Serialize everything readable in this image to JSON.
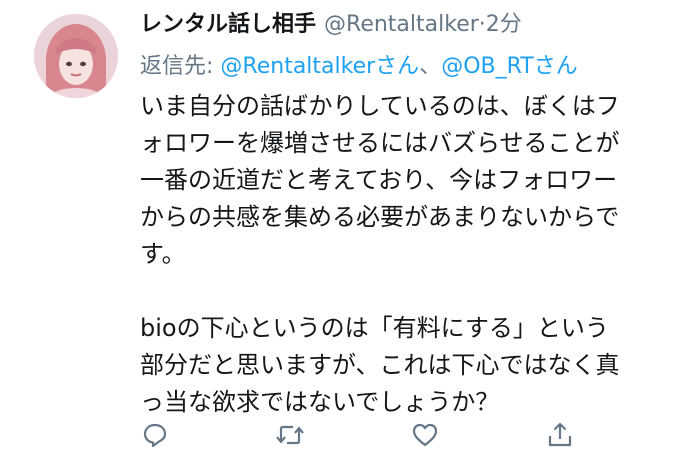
{
  "user": {
    "display_name": "レンタル話し相手",
    "handle": "@Rentaltalker",
    "separator": "·",
    "time": "2分"
  },
  "reply": {
    "prefix": "返信先:",
    "mention1": "@Rentaltalkerさん",
    "joiner": "、",
    "mention2": "@OB_RTさん"
  },
  "tweet": {
    "lines": [
      "いま自分の話ばかりしているのは、ぼくはフ",
      "ォロワーを爆増させるにはバズらせることが",
      "一番の近道だと考えており、今はフォロワー",
      "からの共感を集める必要があまりないからで",
      "す。",
      "",
      "bioの下心というのは「有料にする」という",
      "部分だと思いますが、これは下心ではなく真",
      "っ当な欲求ではないでしょうか？"
    ]
  },
  "actions": {
    "icons": [
      "reply-icon",
      "retweet-icon",
      "like-icon",
      "share-icon"
    ]
  },
  "colors": {
    "text": "#14171a",
    "secondary": "#657786",
    "accent": "#1da1f2",
    "background": "#ffffff"
  }
}
